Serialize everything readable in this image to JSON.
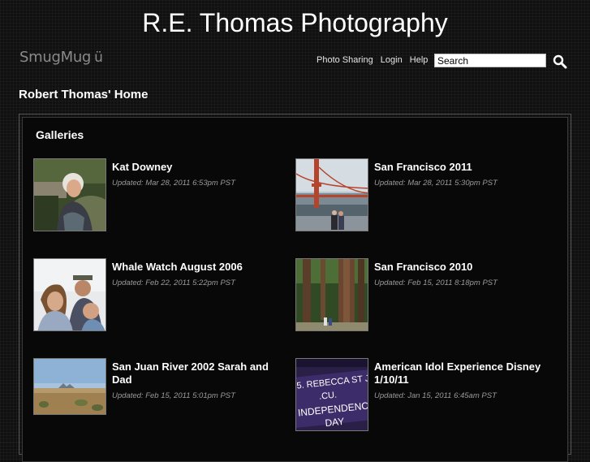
{
  "site": {
    "title": "R.E. Thomas Photography",
    "logo_text": "SmugMug",
    "logo_smile": "ü"
  },
  "nav": {
    "items": [
      "Photo Sharing",
      "Login",
      "Help"
    ]
  },
  "search": {
    "value": "Search"
  },
  "page": {
    "title": "Robert Thomas' Home"
  },
  "galleries": {
    "heading": "Galleries",
    "items": [
      {
        "title": "Kat Downey",
        "updated": "Updated: Mar 28, 2011 6:53pm PST"
      },
      {
        "title": "San Francisco 2011",
        "updated": "Updated: Mar 28, 2011 5:30pm PST"
      },
      {
        "title": "Whale Watch August 2006",
        "updated": "Updated: Feb 22, 2011 5:22pm PST"
      },
      {
        "title": "San Francisco 2010",
        "updated": "Updated: Feb 15, 2011 8:18pm PST"
      },
      {
        "title": "San Juan River 2002 Sarah and Dad",
        "updated": "Updated: Feb 15, 2011 5:01pm PST"
      },
      {
        "title": "American Idol Experience Disney 1/10/11",
        "updated": "Updated: Jan 15, 2011 6:45am PST"
      }
    ],
    "sign_text": [
      "5. REBECCA ST JE",
      ".CU.",
      "INDEPENDENC",
      "DAY"
    ]
  }
}
